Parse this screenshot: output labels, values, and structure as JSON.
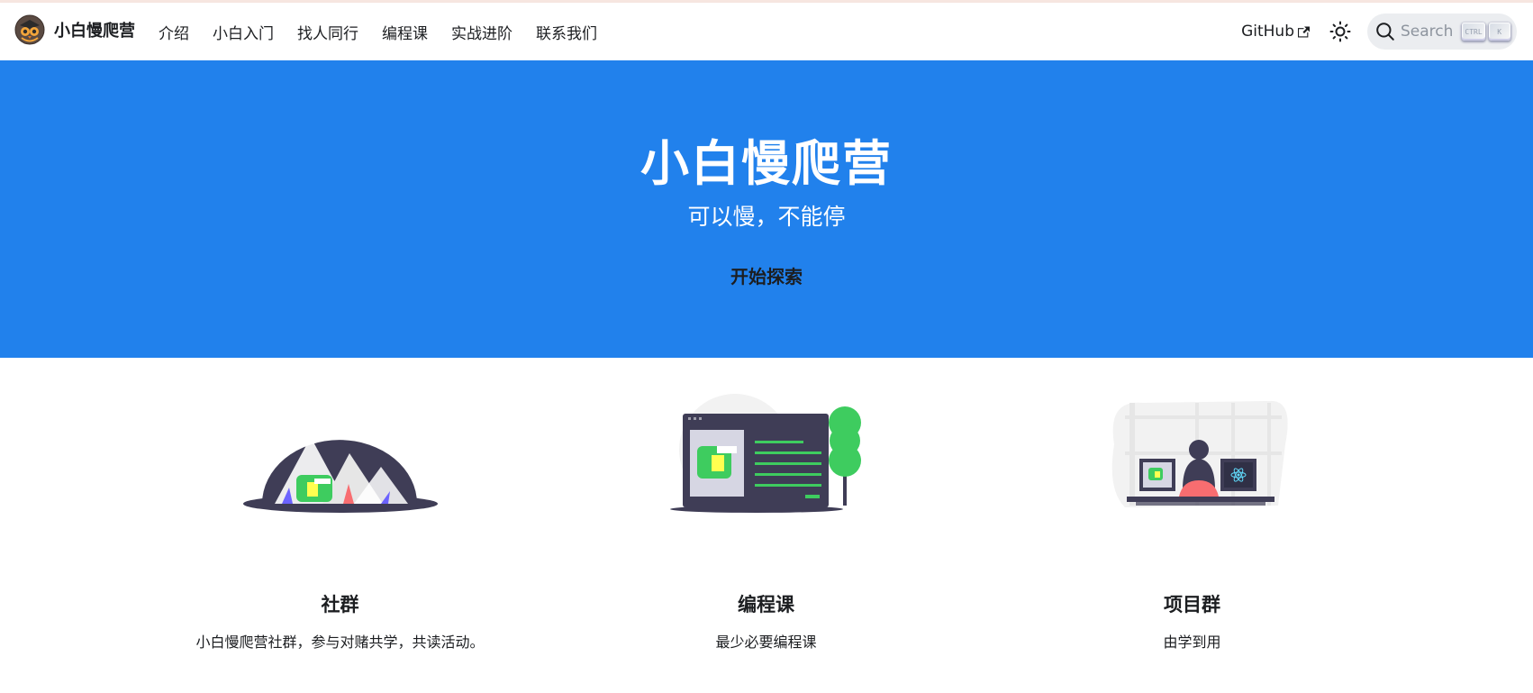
{
  "navbar": {
    "brand_title": "小白慢爬营",
    "links": [
      "介绍",
      "小白入门",
      "找人同行",
      "编程课",
      "实战进阶",
      "联系我们"
    ],
    "github_label": "GitHub",
    "search": {
      "placeholder": "Search",
      "key_ctrl": "CTRL",
      "key_k": "K"
    }
  },
  "hero": {
    "title": "小白慢爬营",
    "subtitle": "可以慢，不能停",
    "cta_label": "开始探索"
  },
  "features": [
    {
      "title": "社群",
      "description": "小白慢爬营社群，参与对赌共学，共读活动。"
    },
    {
      "title": "编程课",
      "description": "最少必要编程课"
    },
    {
      "title": "项目群",
      "description": "由学到用"
    }
  ],
  "colors": {
    "hero_bg": "#2181ec",
    "dino_green": "#3ecc5f",
    "dark_navy": "#3f3d56"
  }
}
